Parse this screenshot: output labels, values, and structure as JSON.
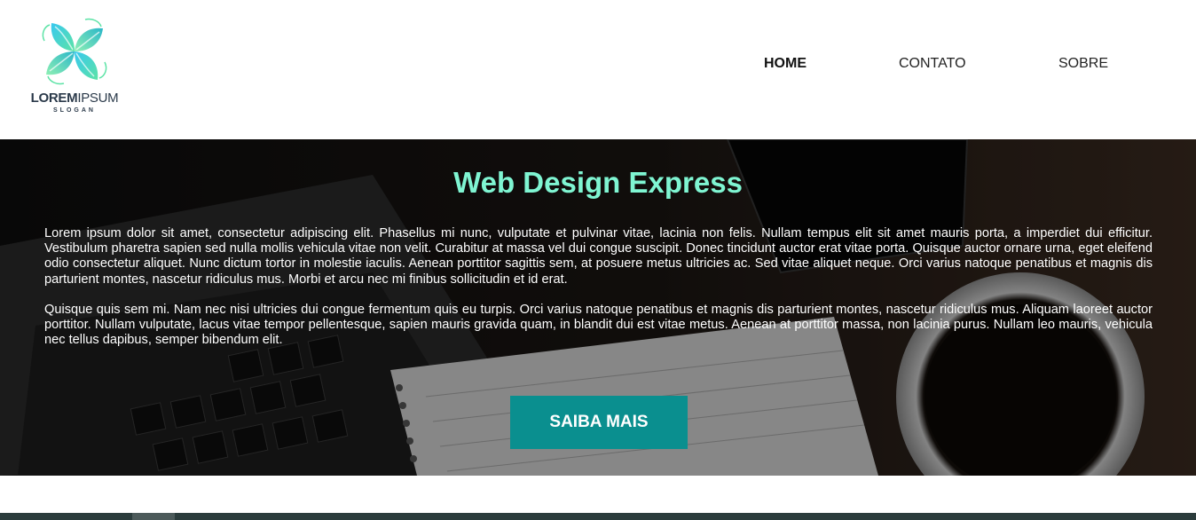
{
  "header": {
    "logo": {
      "word_bold": "LOREM",
      "word_light": "IPSUM",
      "slogan": "SLOGAN"
    },
    "nav": [
      {
        "label": "HOME",
        "active": true
      },
      {
        "label": "CONTATO",
        "active": false
      },
      {
        "label": "SOBRE",
        "active": false
      }
    ]
  },
  "hero": {
    "title": "Web Design Express",
    "paragraphs": [
      "Lorem ipsum dolor sit amet, consectetur adipiscing elit. Phasellus mi nunc, vulputate et pulvinar vitae, lacinia non felis. Nullam tempus elit sit amet mauris porta, a imperdiet dui efficitur. Vestibulum pharetra sapien sed nulla mollis vehicula vitae non velit. Curabitur at massa vel dui congue suscipit. Donec tincidunt auctor erat vitae porta. Quisque auctor ornare urna, eget eleifend odio consectetur aliquet. Nunc dictum tortor in molestie iaculis. Aenean porttitor sagittis sem, at posuere metus ultricies ac. Sed vitae aliquet neque. Orci varius natoque penatibus et magnis dis parturient montes, nascetur ridiculus mus. Morbi et arcu nec mi finibus sollicitudin et id erat.",
      "Quisque quis sem mi. Nam nec nisi ultricies dui congue fermentum quis eu turpis. Orci varius natoque penatibus et magnis dis parturient montes, nascetur ridiculus mus. Aliquam laoreet auctor porttitor. Nullam vulputate, lacus vitae tempor pellentesque, sapien mauris gravida quam, in blandit dui est vitae metus. Aenean at porttitor massa, non lacinia purus. Nullam leo mauris, vehicula nec tellus dapibus, semper bibendum elit."
    ],
    "cta_label": "SAIBA MAIS",
    "background_icon": "laptop-coffee-photo"
  },
  "colors": {
    "title": "#7ff5d2",
    "cta_background": "#0a8f8f",
    "hero_overlay": "#141414",
    "logo_gradient_start": "#38c8ef",
    "logo_gradient_end": "#5ce3a6"
  }
}
